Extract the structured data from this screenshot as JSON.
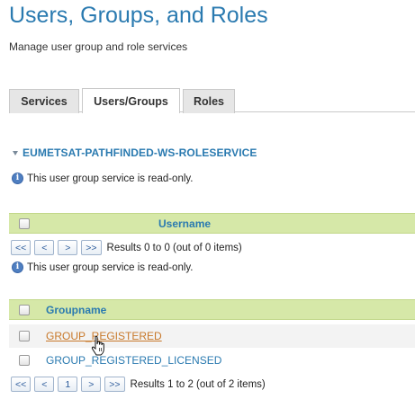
{
  "page": {
    "title": "Users, Groups, and Roles",
    "subtitle": "Manage user group and role services"
  },
  "tabs": [
    {
      "label": "Services",
      "active": false
    },
    {
      "label": "Users/Groups",
      "active": true
    },
    {
      "label": "Roles",
      "active": false
    }
  ],
  "service": {
    "name": "EUMETSAT-PATHFINDED-WS-ROLESERVICE",
    "read_only_notice": "This user group service is read-only."
  },
  "users_grid": {
    "column_header": "Username",
    "pager": {
      "first": "<<",
      "prev": "<",
      "next": ">",
      "last": ">>",
      "info": "Results 0 to 0 (out of 0 items)"
    },
    "read_only_notice": "This user group service is read-only."
  },
  "groups_grid": {
    "column_header": "Groupname",
    "rows": [
      {
        "name": "GROUP_REGISTERED"
      },
      {
        "name": "GROUP_REGISTERED_LICENSED"
      }
    ],
    "pager": {
      "first": "<<",
      "prev": "<",
      "page": "1",
      "next": ">",
      "last": ">>",
      "info": "Results 1 to 2 (out of 2 items)"
    }
  },
  "colors": {
    "accent": "#2a7ab0",
    "grid_header_bg": "#d6e8a8",
    "hover_link": "#c8782a"
  },
  "icons": {
    "collapse": "triangle-down-icon",
    "info": "info-icon",
    "cursor": "hand-pointer-icon"
  }
}
